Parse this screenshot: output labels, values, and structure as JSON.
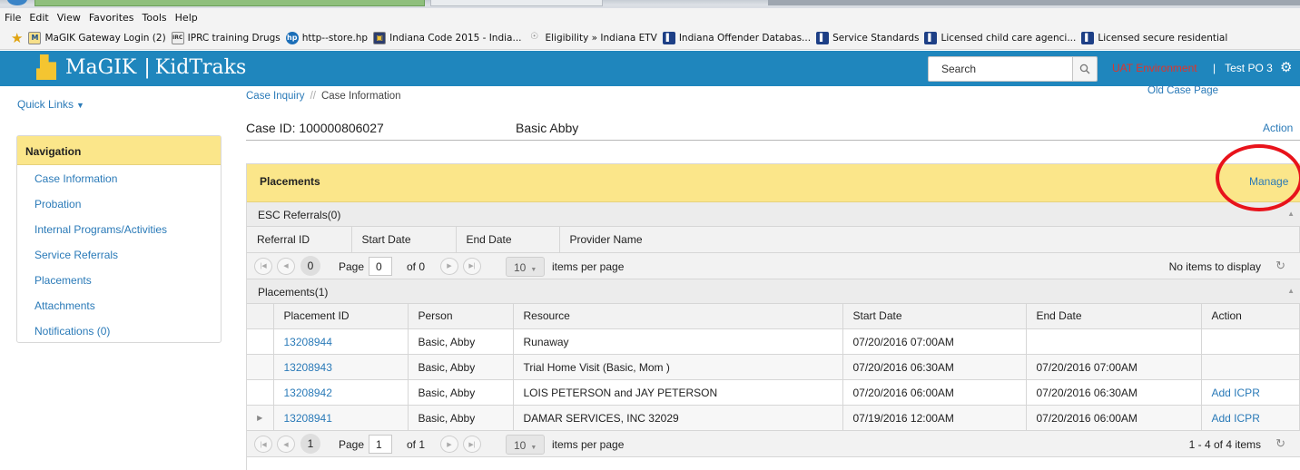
{
  "browser": {
    "menu": [
      "File",
      "Edit",
      "View",
      "Favorites",
      "Tools",
      "Help"
    ],
    "favorites": [
      {
        "label": "MaGIK Gateway Login (2)",
        "icon": "magik-icon"
      },
      {
        "label": "IPRC training Drugs",
        "icon": "iprc-icon"
      },
      {
        "label": "http--store.hp",
        "icon": "hp-icon"
      },
      {
        "label": "Indiana Code 2015 - India...",
        "icon": "indiana-code-icon"
      },
      {
        "label": "Eligibility » Indiana ETV",
        "icon": "etv-icon"
      },
      {
        "label": "Indiana Offender Databas...",
        "icon": "bookmark-icon"
      },
      {
        "label": "Service Standards",
        "icon": "bookmark-icon"
      },
      {
        "label": "Licensed child care agenci...",
        "icon": "bookmark-icon"
      },
      {
        "label": "Licensed secure residential",
        "icon": "bookmark-icon"
      }
    ]
  },
  "app": {
    "brand_left": "MaGIK",
    "brand_sep": "|",
    "brand_right": "KidTraks",
    "search_placeholder": "Search",
    "environment": "UAT Environment",
    "user_sep": "|",
    "user_name": "Test PO 3",
    "accent_color": "#1f86bd",
    "highlight_color": "#fbe68a"
  },
  "sidebar": {
    "quick_links": "Quick Links",
    "nav_title": "Navigation",
    "items": [
      {
        "label": "Case Information"
      },
      {
        "label": "Probation"
      },
      {
        "label": "Internal Programs/Activities"
      },
      {
        "label": "Service Referrals"
      },
      {
        "label": "Placements"
      },
      {
        "label": "Attachments"
      },
      {
        "label": "Notifications (0)"
      }
    ]
  },
  "main": {
    "breadcrumb": [
      "Case Inquiry",
      "//",
      "Case Information"
    ],
    "old_case_link": "Old Case Page",
    "case_id": "Case ID: 100000806027",
    "case_name": "Basic Abby",
    "action_menu": "Action",
    "panel_title": "Placements",
    "manage_link": "Manage",
    "esc": {
      "group_title": "ESC Referrals(0)",
      "columns": [
        "Referral ID",
        "Start Date",
        "End Date",
        "Provider Name"
      ],
      "pager": {
        "current": "0",
        "page_label": "Page",
        "page_value": "0",
        "of_label": "of 0",
        "size": "10",
        "per_page": "items per page",
        "summary": "No items to display"
      }
    },
    "placements": {
      "group_title": "Placements(1)",
      "columns": [
        "Placement ID",
        "Person",
        "Resource",
        "Start Date",
        "End Date",
        "Action"
      ],
      "rows": [
        {
          "id": "13208944",
          "person": "Basic, Abby",
          "resource": "Runaway",
          "start": "07/20/2016 07:00AM",
          "end": "",
          "action": "",
          "expandable": false
        },
        {
          "id": "13208943",
          "person": "Basic, Abby",
          "resource": "Trial Home Visit (Basic, Mom )",
          "start": "07/20/2016 06:30AM",
          "end": "07/20/2016 07:00AM",
          "action": "",
          "expandable": false
        },
        {
          "id": "13208942",
          "person": "Basic, Abby",
          "resource": "LOIS PETERSON and JAY PETERSON",
          "start": "07/20/2016 06:00AM",
          "end": "07/20/2016 06:30AM",
          "action": "Add ICPR",
          "expandable": false
        },
        {
          "id": "13208941",
          "person": "Basic, Abby",
          "resource": "DAMAR SERVICES, INC 32029",
          "start": "07/19/2016 12:00AM",
          "end": "07/20/2016 06:00AM",
          "action": "Add ICPR",
          "expandable": true
        }
      ],
      "pager": {
        "current": "1",
        "page_label": "Page",
        "page_value": "1",
        "of_label": "of 1",
        "size": "10",
        "per_page": "items per page",
        "summary": "1 - 4 of 4 items"
      }
    }
  }
}
